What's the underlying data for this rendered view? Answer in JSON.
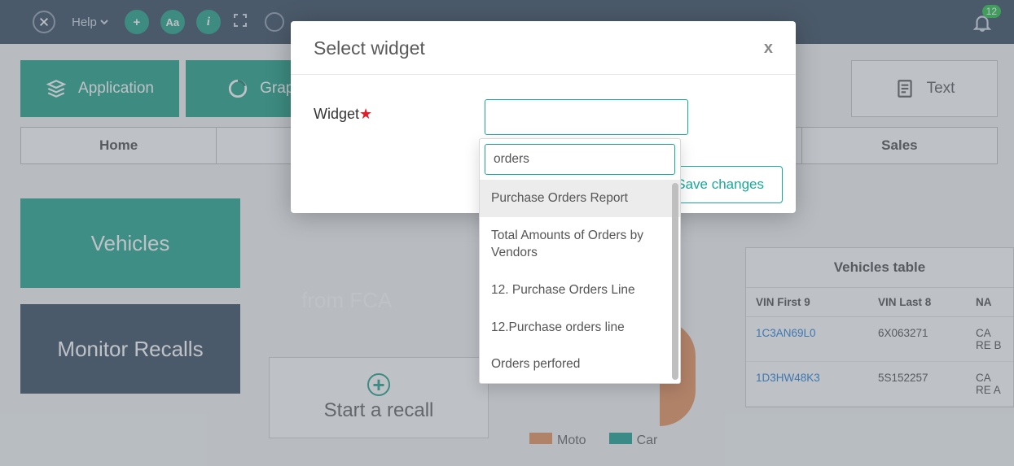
{
  "topbar": {
    "help_label": "Help",
    "aa_label": "Aa",
    "info_label": "i",
    "plus_label": "+",
    "badge_count": "12"
  },
  "widget_tiles": {
    "application": "Application",
    "graph": "Graph",
    "text": "Text"
  },
  "tabs": {
    "home": "Home",
    "sales": "Sales"
  },
  "cards": {
    "vehicles": "Vehicles",
    "monitor_recalls": "Monitor Recalls",
    "from_fca": "from FCA",
    "start_recall": "Start a recall"
  },
  "legend": {
    "moto": "Moto",
    "car": "Car"
  },
  "table": {
    "title": "Vehicles table",
    "col_vin9": "VIN First 9",
    "col_vin8": "VIN Last 8",
    "col_na": "NA",
    "rows": [
      {
        "vin9": "1C3AN69L0",
        "vin8": "6X063271",
        "na": "CA RE B"
      },
      {
        "vin9": "1D3HW48K3",
        "vin8": "5S152257",
        "na": "CA RE A"
      }
    ]
  },
  "modal": {
    "title": "Select widget",
    "widget_label": "Widget",
    "save_label": "Save changes",
    "close_label": "x"
  },
  "dropdown": {
    "search_value": "orders",
    "options": [
      "Purchase Orders Report",
      "Total Amounts of Orders by Vendors",
      "12. Purchase Orders Line",
      "12.Purchase orders line",
      "Orders perfored"
    ]
  }
}
